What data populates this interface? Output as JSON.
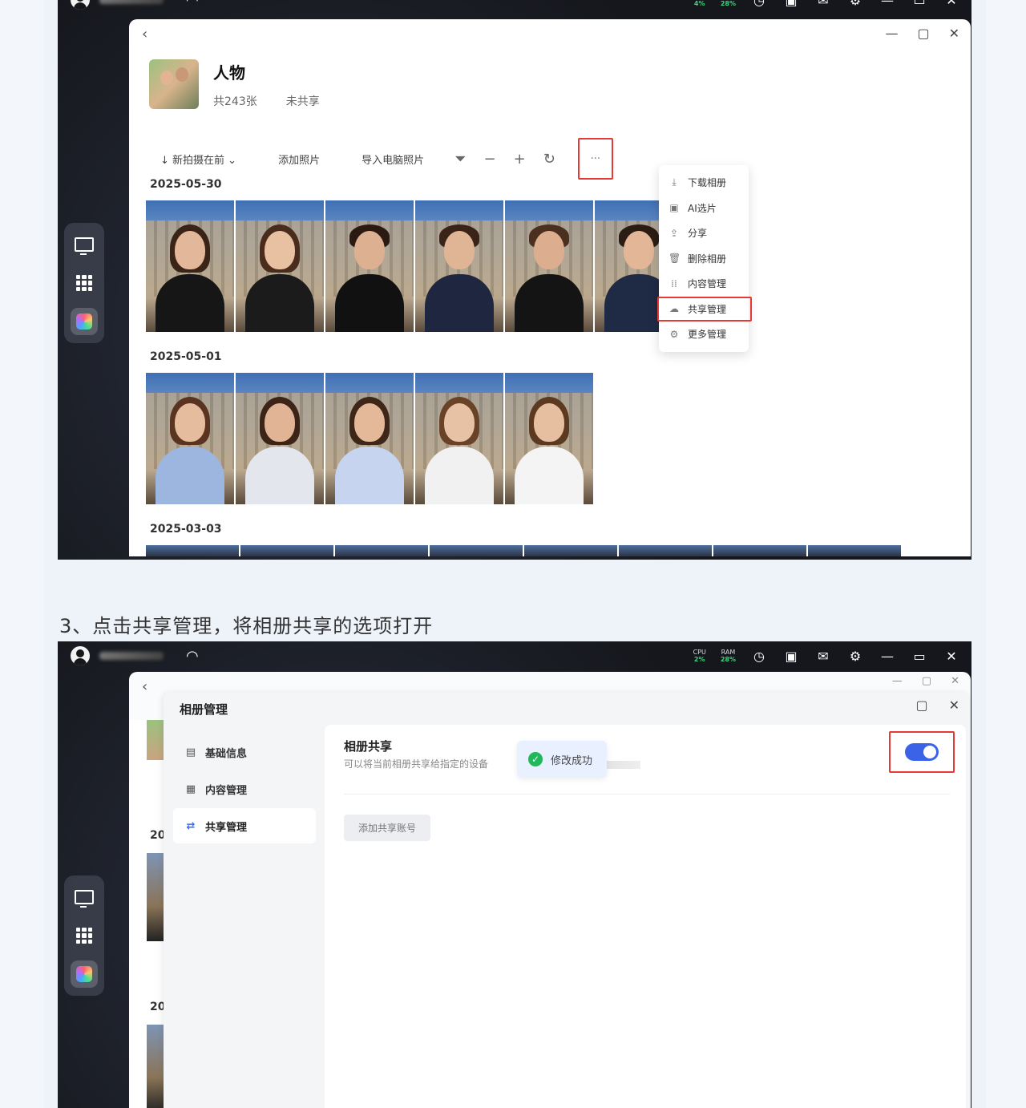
{
  "system": {
    "cpu_label": "CPU",
    "ram_label": "RAM",
    "shot1": {
      "cpu": "4%",
      "ram": "28%"
    },
    "shot2": {
      "cpu": "2%",
      "ram": "28%"
    }
  },
  "album": {
    "title": "人物",
    "count": "共243张",
    "share_status": "未共享"
  },
  "toolbar": {
    "sort_label": "↓ 新拍摄在前 ⌄",
    "add_photos": "添加照片",
    "import_pc": "导入电脑照片",
    "more": "···"
  },
  "dates": [
    "2025-05-30",
    "2025-05-01",
    "2025-03-03"
  ],
  "menu": [
    {
      "icon": "⤓",
      "label": "下载相册"
    },
    {
      "icon": "▣",
      "label": "AI选片"
    },
    {
      "icon": "⇪",
      "label": "分享"
    },
    {
      "icon": "🗑",
      "label": "删除相册"
    },
    {
      "icon": "⁞⁞",
      "label": "内容管理"
    },
    {
      "icon": "☁",
      "label": "共享管理"
    },
    {
      "icon": "⚙",
      "label": "更多管理"
    }
  ],
  "caption": "3、点击共享管理，将相册共享的选项打开",
  "dialog": {
    "title": "相册管理",
    "nav": [
      {
        "icon": "▤",
        "label": "基础信息"
      },
      {
        "icon": "▦",
        "label": "内容管理"
      },
      {
        "icon": "⇄",
        "label": "共享管理"
      }
    ],
    "section_title": "相册共享",
    "section_desc": "可以将当前相册共享给指定的设备",
    "add_button": "添加共享账号",
    "toast": "修改成功",
    "share_enabled": true
  },
  "under_dates": [
    "20",
    "20"
  ],
  "colors": {
    "highlight": "#e53935",
    "toggle_on": "#3b63e8",
    "success": "#1fb85a"
  }
}
